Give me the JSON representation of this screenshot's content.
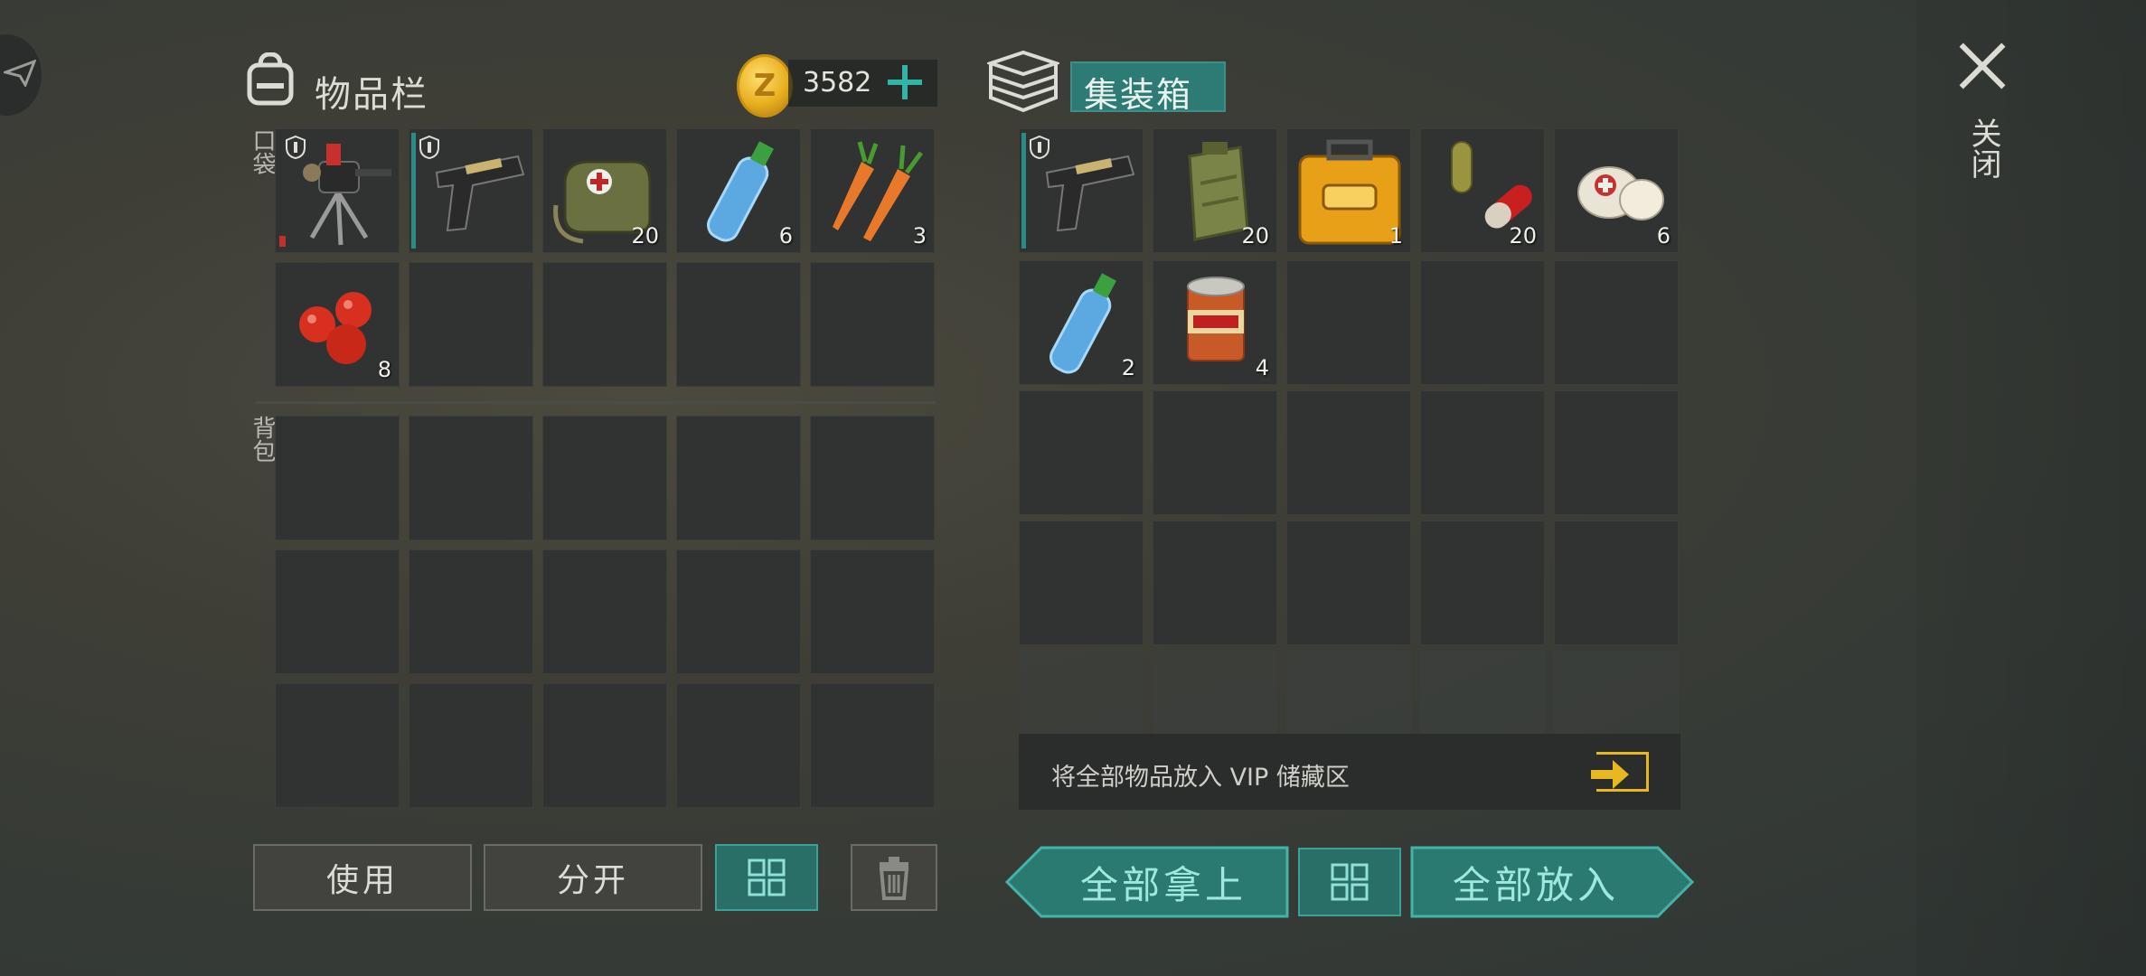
{
  "inventory": {
    "title": "物品栏",
    "pocket_label": "口袋",
    "backpack_label": "背包",
    "coins": "3582",
    "pocket_items": [
      {
        "name": "turret",
        "count": ""
      },
      {
        "name": "pistol",
        "count": ""
      },
      {
        "name": "medkit-bag",
        "count": "20"
      },
      {
        "name": "water-bottle",
        "count": "6"
      },
      {
        "name": "carrots",
        "count": "3"
      },
      {
        "name": "berries",
        "count": "8"
      }
    ]
  },
  "container": {
    "title": "集装箱",
    "items": [
      {
        "name": "pistol",
        "count": ""
      },
      {
        "name": "jerrycan",
        "count": "20"
      },
      {
        "name": "toolbox",
        "count": "1"
      },
      {
        "name": "pills",
        "count": "20"
      },
      {
        "name": "bandages",
        "count": "6"
      },
      {
        "name": "water-bottle",
        "count": "2"
      },
      {
        "name": "canned-food",
        "count": "4"
      }
    ],
    "vip_text": "将全部物品放入 VIP 储藏区"
  },
  "buttons": {
    "use": "使用",
    "split": "分开",
    "take_all": "全部拿上",
    "put_all": "全部放入"
  },
  "close_label": "关闭",
  "colors": {
    "teal_accent": "#2a7a72",
    "coin_gold": "#e8b020",
    "vip_arrow": "#e8b820"
  }
}
